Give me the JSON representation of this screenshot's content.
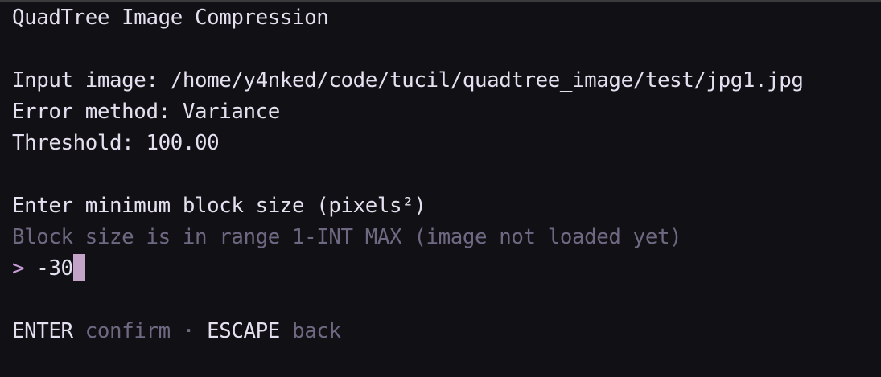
{
  "title": "QuadTree Image Compression",
  "info": {
    "input_label": "Input image: ",
    "input_value": "/home/y4nked/code/tucil/quadtree_image/test/jpg1.jpg",
    "method_label": "Error method: ",
    "method_value": "Variance",
    "threshold_label": "Threshold: ",
    "threshold_value": "100.00"
  },
  "prompt": {
    "question": "Enter minimum block size (pixels²)",
    "hint": "Block size is in range 1-INT_MAX (image not loaded yet)",
    "marker": ">",
    "value": "-30"
  },
  "help": {
    "enter_key": "ENTER",
    "enter_action": "confirm",
    "separator": "·",
    "escape_key": "ESCAPE",
    "escape_action": "back"
  },
  "colors": {
    "background": "#111014",
    "text": "#e4e0f0",
    "dim": "#6f6882",
    "accent": "#c79ad8",
    "cursor": "#c4a3c9"
  }
}
